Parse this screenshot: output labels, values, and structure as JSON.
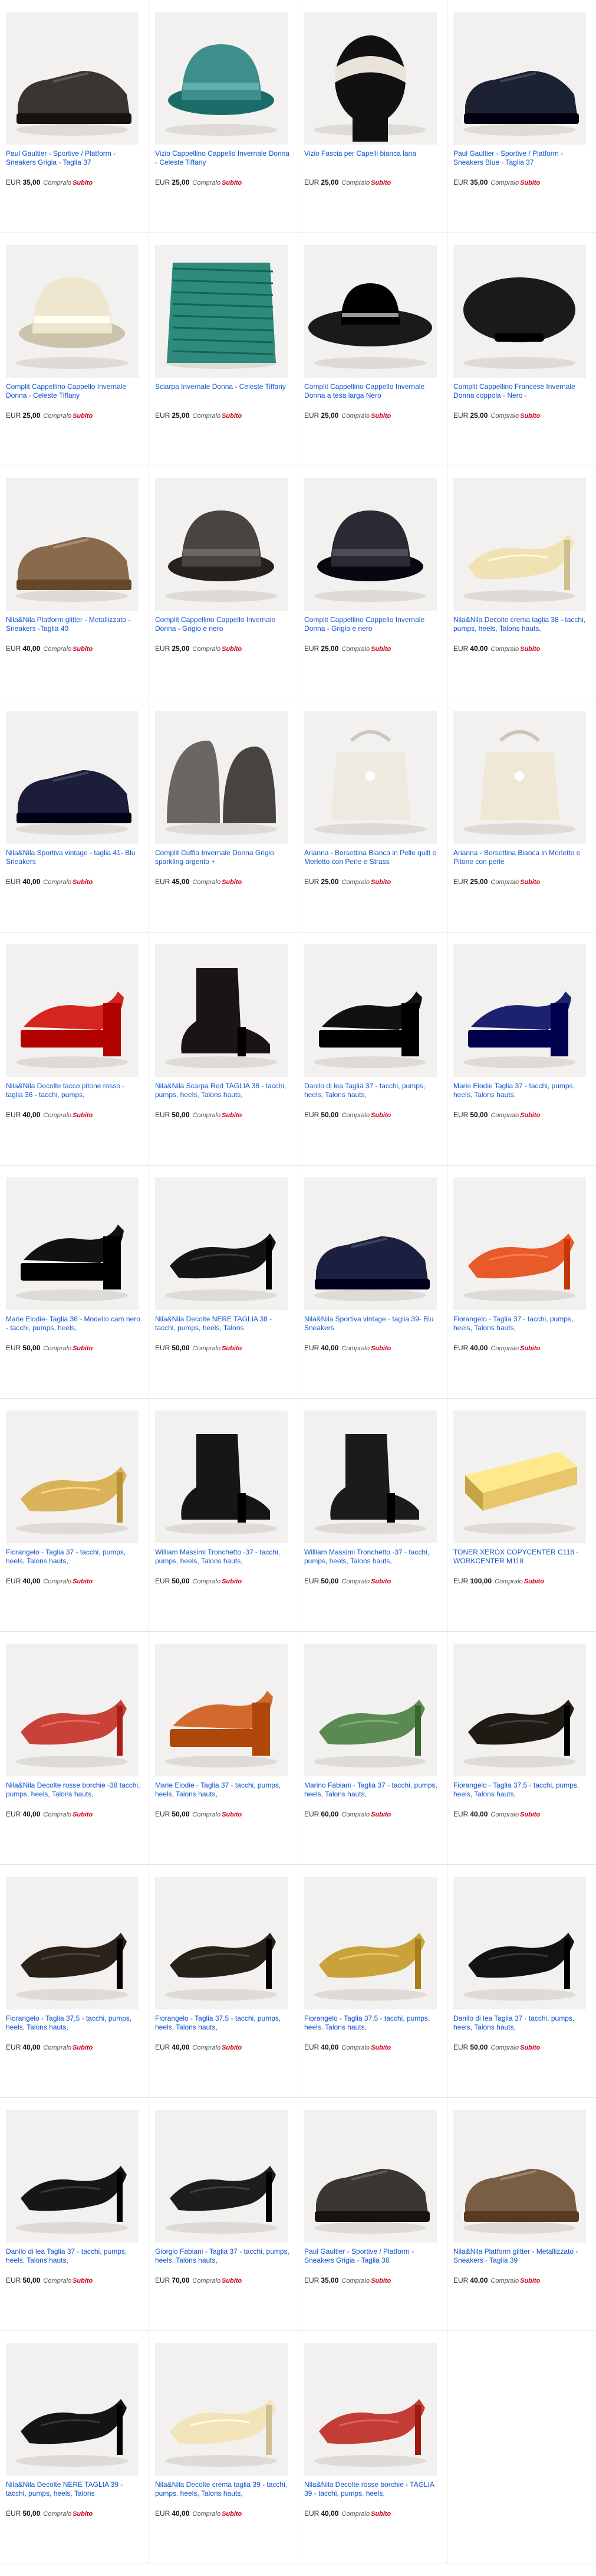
{
  "labels": {
    "buy_now": "Compralo",
    "now": "Subito"
  },
  "palette": {
    "link": "#1155cc",
    "sale": "#d0021b",
    "thumb_bg": "#f2f1ef"
  },
  "listings": [
    {
      "title": "Paul Gaultier - Sportive / Platform - Sneakers Grigia - Taglia 37",
      "currency": "EUR",
      "price": "35,00",
      "icon": "shoe-photo",
      "color": "#3a3530",
      "kind": "sneaker"
    },
    {
      "title": "Vizio Cappellino Cappello Invernale Donna - Celeste Tiffany",
      "currency": "EUR",
      "price": "25,00",
      "icon": "hat-photo",
      "color": "#3e8f8c",
      "kind": "bucket"
    },
    {
      "title": "Vizio Fascia per Capelli bianca lana",
      "currency": "EUR",
      "price": "25,00",
      "icon": "headband-photo",
      "color": "#e8e4dc",
      "kind": "headband"
    },
    {
      "title": "Paul Gaultier - Sportive / Platform - Sneakers Blue - Taglia 37",
      "currency": "EUR",
      "price": "35,00",
      "icon": "shoe-photo",
      "color": "#1c2233",
      "kind": "sneaker"
    },
    {
      "title": "Complit Cappellino Cappello Invernale Donna - Celeste Tiffany",
      "currency": "EUR",
      "price": "25,00",
      "icon": "hat-photo",
      "color": "#efe6cf",
      "kind": "cloche"
    },
    {
      "title": "Sciarpa Invernale Donna - Celeste Tiffany",
      "currency": "EUR",
      "price": "25,00",
      "icon": "scarf-photo",
      "color": "#2f8a7c",
      "kind": "scarf"
    },
    {
      "title": "Complit Cappellino Cappello Invernale Donna a tesa larga Nero",
      "currency": "EUR",
      "price": "25,00",
      "icon": "hat-photo",
      "color": "#1a1a1a",
      "kind": "widebrim"
    },
    {
      "title": "Complit Cappellino Francese Invernale Donna coppola - Nero -",
      "currency": "EUR",
      "price": "25,00",
      "icon": "hat-photo",
      "color": "#1a1a1a",
      "kind": "beret"
    },
    {
      "title": "Nila&Nila Platform glitter - Metallizzato - Sneakers -Taglia 40",
      "currency": "EUR",
      "price": "40,00",
      "icon": "shoe-photo",
      "color": "#8a6a4c",
      "kind": "sneaker"
    },
    {
      "title": "Complit Cappellino Cappello Invernale Donna - Grigio e nero",
      "currency": "EUR",
      "price": "25,00",
      "icon": "hat-photo",
      "color": "#4a4440",
      "kind": "cloche"
    },
    {
      "title": "Complit Cappellino Cappello Invernale Donna - Grigio e nero",
      "currency": "EUR",
      "price": "25,00",
      "icon": "hat-photo",
      "color": "#2a2a33",
      "kind": "cloche"
    },
    {
      "title": "Nila&Nila Decolte crema taglia 38 - tacchi, pumps, heels, Talons hauts,",
      "currency": "EUR",
      "price": "40,00",
      "icon": "shoe-photo",
      "color": "#f1e2b4",
      "kind": "pump"
    },
    {
      "title": "Nila&Nila Sportiva vintage - taglia 41- Blu Sneakers",
      "currency": "EUR",
      "price": "40,00",
      "icon": "shoe-photo",
      "color": "#1c1d3a",
      "kind": "sneaker"
    },
    {
      "title": "Complit Cuffia Invernale Donna Grigio sparkling argento +",
      "currency": "EUR",
      "price": "45,00",
      "icon": "beanie-photo",
      "color": "#6a6663",
      "kind": "beanie"
    },
    {
      "title": "Arianna - Borsettina Bianca in Pelle quilt e Merletto con Perle e Strass",
      "currency": "EUR",
      "price": "25,00",
      "icon": "bag-photo",
      "color": "#eeeae0",
      "kind": "bag"
    },
    {
      "title": "Arianna - Borsettina Bianca in Merletto e Pitone con perle",
      "currency": "EUR",
      "price": "25,00",
      "icon": "bag-photo",
      "color": "#efe8d6",
      "kind": "bag"
    },
    {
      "title": "Nila&Nila Decolte tacco pitone rosso - taglia 36 - tacchi, pumps,",
      "currency": "EUR",
      "price": "40,00",
      "icon": "shoe-photo",
      "color": "#d42520",
      "kind": "platform"
    },
    {
      "title": "Nila&Nila Scarpa Red TAGLIA 38 - tacchi, pumps, heels, Talons hauts,",
      "currency": "EUR",
      "price": "50,00",
      "icon": "boot-photo",
      "color": "#1a1414",
      "kind": "bootie"
    },
    {
      "title": "Danilo di lea Taglia 37 - tacchi, pumps, heels, Talons hauts,",
      "currency": "EUR",
      "price": "50,00",
      "icon": "shoe-photo",
      "color": "#111111",
      "kind": "platform"
    },
    {
      "title": "Marie Elodie Taglia 37 - tacchi, pumps, heels, Talons hauts,",
      "currency": "EUR",
      "price": "50,00",
      "icon": "shoe-photo",
      "color": "#1d2270",
      "kind": "platform"
    },
    {
      "title": "Marie Elodie- Taglia 36 - Modello cam nero - tacchi, pumps, heels,",
      "currency": "EUR",
      "price": "50,00",
      "icon": "shoe-photo",
      "color": "#111111",
      "kind": "platform"
    },
    {
      "title": "Nila&Nila Decolte NERE TAGLIA 38 - tacchi, pumps, heels, Talons",
      "currency": "EUR",
      "price": "50,00",
      "icon": "shoe-photo",
      "color": "#141414",
      "kind": "pump"
    },
    {
      "title": "Nila&Nila Sportiva vintage - taglia 39- Blu Sneakers",
      "currency": "EUR",
      "price": "40,00",
      "icon": "shoe-photo",
      "color": "#1c2040",
      "kind": "sneaker"
    },
    {
      "title": "Fiorangelo - Taglia 37 - tacchi, pumps, heels, Talons hauts,",
      "currency": "EUR",
      "price": "40,00",
      "icon": "shoe-photo",
      "color": "#e85a2a",
      "kind": "pump"
    },
    {
      "title": "Fiorangelo - Taglia 37 - tacchi, pumps, heels, Talons hauts,",
      "currency": "EUR",
      "price": "40,00",
      "icon": "shoe-photo",
      "color": "#d9b25a",
      "kind": "pump"
    },
    {
      "title": "William Massimi Tronchetto -37 - tacchi, pumps, heels, Talons hauts,",
      "currency": "EUR",
      "price": "50,00",
      "icon": "boot-photo",
      "color": "#161616",
      "kind": "bootie"
    },
    {
      "title": "William Massimi Tronchetto -37 - tacchi, pumps, heels, Talons hauts,",
      "currency": "EUR",
      "price": "50,00",
      "icon": "boot-photo",
      "color": "#1b1b1b",
      "kind": "bootie"
    },
    {
      "title": "TONER XEROX COPYCENTER C118 - WORKCENTER M118",
      "currency": "EUR",
      "price": "100,00",
      "icon": "toner-box-photo",
      "color": "#e9c66a",
      "kind": "box"
    },
    {
      "title": "Nila&Nila Decolte rosse borchie -38 tacchi, pumps, heels, Talons hauts,",
      "currency": "EUR",
      "price": "40,00",
      "icon": "shoe-photo",
      "color": "#c8423a",
      "kind": "pump"
    },
    {
      "title": "Marie Elodie - Taglia 37 - tacchi, pumps, heels, Talons hauts,",
      "currency": "EUR",
      "price": "50,00",
      "icon": "shoe-photo",
      "color": "#d26a2e",
      "kind": "platform"
    },
    {
      "title": "Marino Fabiani - Taglia 37 - tacchi, pumps, heels, Talons hauts,",
      "currency": "EUR",
      "price": "60,00",
      "icon": "shoe-photo",
      "color": "#5a8a52",
      "kind": "pump"
    },
    {
      "title": "Fiorangelo - Taglia 37,5 - tacchi, pumps, heels, Talons hauts,",
      "currency": "EUR",
      "price": "40,00",
      "icon": "shoe-photo",
      "color": "#201a14",
      "kind": "pump"
    },
    {
      "title": "Fiorangelo - Taglia 37,5 - tacchi, pumps, heels, Talons hauts,",
      "currency": "EUR",
      "price": "40,00",
      "icon": "shoe-photo",
      "color": "#2a2118",
      "kind": "pump"
    },
    {
      "title": "Fiorangelo - Taglia 37,5 - tacchi, pumps, heels, Talons hauts,",
      "currency": "EUR",
      "price": "40,00",
      "icon": "shoe-photo",
      "color": "#262219",
      "kind": "pump"
    },
    {
      "title": "Fiorangelo - Taglia 37,5 - tacchi, pumps, heels, Talons hauts,",
      "currency": "EUR",
      "price": "40,00",
      "icon": "shoe-photo",
      "color": "#c9a23c",
      "kind": "pump"
    },
    {
      "title": "Danilo di lea Taglia 37 - tacchi, pumps, heels, Talons hauts,",
      "currency": "EUR",
      "price": "50,00",
      "icon": "shoe-photo",
      "color": "#121212",
      "kind": "pump"
    },
    {
      "title": "Danilo di lea Taglia 37 - tacchi, pumps, heels, Talons hauts,",
      "currency": "EUR",
      "price": "50,00",
      "icon": "shoe-photo",
      "color": "#161616",
      "kind": "pump"
    },
    {
      "title": "Giorgio Fabiani - Taglia 37 - tacchi, pumps, heels, Talons hauts,",
      "currency": "EUR",
      "price": "70,00",
      "icon": "shoe-photo",
      "color": "#1d1d1d",
      "kind": "pump"
    },
    {
      "title": "Paul Gaultier - Sportive / Platform - Sneakers Grigia - Taglia 38",
      "currency": "EUR",
      "price": "35,00",
      "icon": "shoe-photo",
      "color": "#3a3632",
      "kind": "sneaker"
    },
    {
      "title": "Nila&Nila Platform glitter - Metallizzato - Sneakers - Taglia 39",
      "currency": "EUR",
      "price": "40,00",
      "icon": "shoe-photo",
      "color": "#7a5e44",
      "kind": "sneaker"
    },
    {
      "title": "Nila&Nila Decolte NERE TAGLIA 39 - tacchi, pumps, heels, Talons",
      "currency": "EUR",
      "price": "50,00",
      "icon": "shoe-photo",
      "color": "#141414",
      "kind": "pump"
    },
    {
      "title": "Nila&Nila Decolte crema taglia 39 - tacchi, pumps, heels, Talons hauts,",
      "currency": "EUR",
      "price": "40,00",
      "icon": "shoe-photo",
      "color": "#f2e4b8",
      "kind": "pump"
    },
    {
      "title": "Nila&Nila Decolte rosse borchie - TAGLIA 39 - tacchi, pumps, heels,",
      "currency": "EUR",
      "price": "40,00",
      "icon": "shoe-photo",
      "color": "#c23d36",
      "kind": "pump"
    }
  ]
}
